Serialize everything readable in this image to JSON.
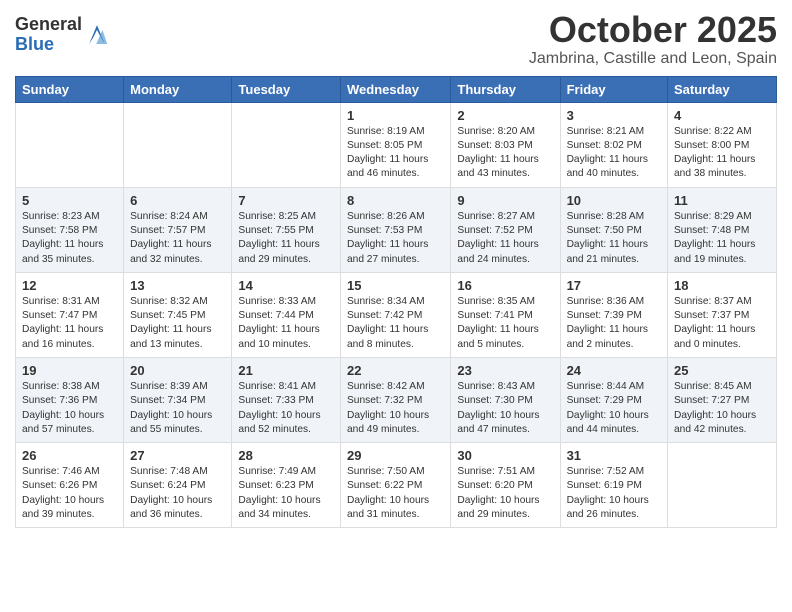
{
  "logo": {
    "general": "General",
    "blue": "Blue"
  },
  "header": {
    "month": "October 2025",
    "location": "Jambrina, Castille and Leon, Spain"
  },
  "days_of_week": [
    "Sunday",
    "Monday",
    "Tuesday",
    "Wednesday",
    "Thursday",
    "Friday",
    "Saturday"
  ],
  "weeks": [
    [
      {
        "day": "",
        "info": ""
      },
      {
        "day": "",
        "info": ""
      },
      {
        "day": "",
        "info": ""
      },
      {
        "day": "1",
        "info": "Sunrise: 8:19 AM\nSunset: 8:05 PM\nDaylight: 11 hours\nand 46 minutes."
      },
      {
        "day": "2",
        "info": "Sunrise: 8:20 AM\nSunset: 8:03 PM\nDaylight: 11 hours\nand 43 minutes."
      },
      {
        "day": "3",
        "info": "Sunrise: 8:21 AM\nSunset: 8:02 PM\nDaylight: 11 hours\nand 40 minutes."
      },
      {
        "day": "4",
        "info": "Sunrise: 8:22 AM\nSunset: 8:00 PM\nDaylight: 11 hours\nand 38 minutes."
      }
    ],
    [
      {
        "day": "5",
        "info": "Sunrise: 8:23 AM\nSunset: 7:58 PM\nDaylight: 11 hours\nand 35 minutes."
      },
      {
        "day": "6",
        "info": "Sunrise: 8:24 AM\nSunset: 7:57 PM\nDaylight: 11 hours\nand 32 minutes."
      },
      {
        "day": "7",
        "info": "Sunrise: 8:25 AM\nSunset: 7:55 PM\nDaylight: 11 hours\nand 29 minutes."
      },
      {
        "day": "8",
        "info": "Sunrise: 8:26 AM\nSunset: 7:53 PM\nDaylight: 11 hours\nand 27 minutes."
      },
      {
        "day": "9",
        "info": "Sunrise: 8:27 AM\nSunset: 7:52 PM\nDaylight: 11 hours\nand 24 minutes."
      },
      {
        "day": "10",
        "info": "Sunrise: 8:28 AM\nSunset: 7:50 PM\nDaylight: 11 hours\nand 21 minutes."
      },
      {
        "day": "11",
        "info": "Sunrise: 8:29 AM\nSunset: 7:48 PM\nDaylight: 11 hours\nand 19 minutes."
      }
    ],
    [
      {
        "day": "12",
        "info": "Sunrise: 8:31 AM\nSunset: 7:47 PM\nDaylight: 11 hours\nand 16 minutes."
      },
      {
        "day": "13",
        "info": "Sunrise: 8:32 AM\nSunset: 7:45 PM\nDaylight: 11 hours\nand 13 minutes."
      },
      {
        "day": "14",
        "info": "Sunrise: 8:33 AM\nSunset: 7:44 PM\nDaylight: 11 hours\nand 10 minutes."
      },
      {
        "day": "15",
        "info": "Sunrise: 8:34 AM\nSunset: 7:42 PM\nDaylight: 11 hours\nand 8 minutes."
      },
      {
        "day": "16",
        "info": "Sunrise: 8:35 AM\nSunset: 7:41 PM\nDaylight: 11 hours\nand 5 minutes."
      },
      {
        "day": "17",
        "info": "Sunrise: 8:36 AM\nSunset: 7:39 PM\nDaylight: 11 hours\nand 2 minutes."
      },
      {
        "day": "18",
        "info": "Sunrise: 8:37 AM\nSunset: 7:37 PM\nDaylight: 11 hours\nand 0 minutes."
      }
    ],
    [
      {
        "day": "19",
        "info": "Sunrise: 8:38 AM\nSunset: 7:36 PM\nDaylight: 10 hours\nand 57 minutes."
      },
      {
        "day": "20",
        "info": "Sunrise: 8:39 AM\nSunset: 7:34 PM\nDaylight: 10 hours\nand 55 minutes."
      },
      {
        "day": "21",
        "info": "Sunrise: 8:41 AM\nSunset: 7:33 PM\nDaylight: 10 hours\nand 52 minutes."
      },
      {
        "day": "22",
        "info": "Sunrise: 8:42 AM\nSunset: 7:32 PM\nDaylight: 10 hours\nand 49 minutes."
      },
      {
        "day": "23",
        "info": "Sunrise: 8:43 AM\nSunset: 7:30 PM\nDaylight: 10 hours\nand 47 minutes."
      },
      {
        "day": "24",
        "info": "Sunrise: 8:44 AM\nSunset: 7:29 PM\nDaylight: 10 hours\nand 44 minutes."
      },
      {
        "day": "25",
        "info": "Sunrise: 8:45 AM\nSunset: 7:27 PM\nDaylight: 10 hours\nand 42 minutes."
      }
    ],
    [
      {
        "day": "26",
        "info": "Sunrise: 7:46 AM\nSunset: 6:26 PM\nDaylight: 10 hours\nand 39 minutes."
      },
      {
        "day": "27",
        "info": "Sunrise: 7:48 AM\nSunset: 6:24 PM\nDaylight: 10 hours\nand 36 minutes."
      },
      {
        "day": "28",
        "info": "Sunrise: 7:49 AM\nSunset: 6:23 PM\nDaylight: 10 hours\nand 34 minutes."
      },
      {
        "day": "29",
        "info": "Sunrise: 7:50 AM\nSunset: 6:22 PM\nDaylight: 10 hours\nand 31 minutes."
      },
      {
        "day": "30",
        "info": "Sunrise: 7:51 AM\nSunset: 6:20 PM\nDaylight: 10 hours\nand 29 minutes."
      },
      {
        "day": "31",
        "info": "Sunrise: 7:52 AM\nSunset: 6:19 PM\nDaylight: 10 hours\nand 26 minutes."
      },
      {
        "day": "",
        "info": ""
      }
    ]
  ]
}
